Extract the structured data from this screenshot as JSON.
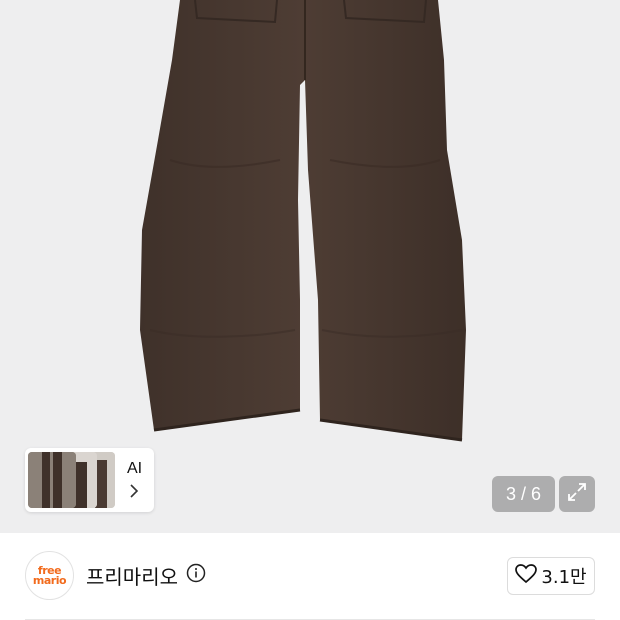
{
  "gallery": {
    "ai_label": "AI",
    "counter": "3 / 6"
  },
  "seller": {
    "logo_line1": "free",
    "logo_line2": "mario",
    "name": "프리마리오",
    "likes": "3.1만"
  },
  "colors": {
    "hero_background": "#eeeeef",
    "pants": "#4a3a32",
    "brand": "#f26b1d"
  },
  "icons": [
    "chevron-right-icon",
    "expand-icon",
    "info-icon",
    "heart-icon"
  ]
}
